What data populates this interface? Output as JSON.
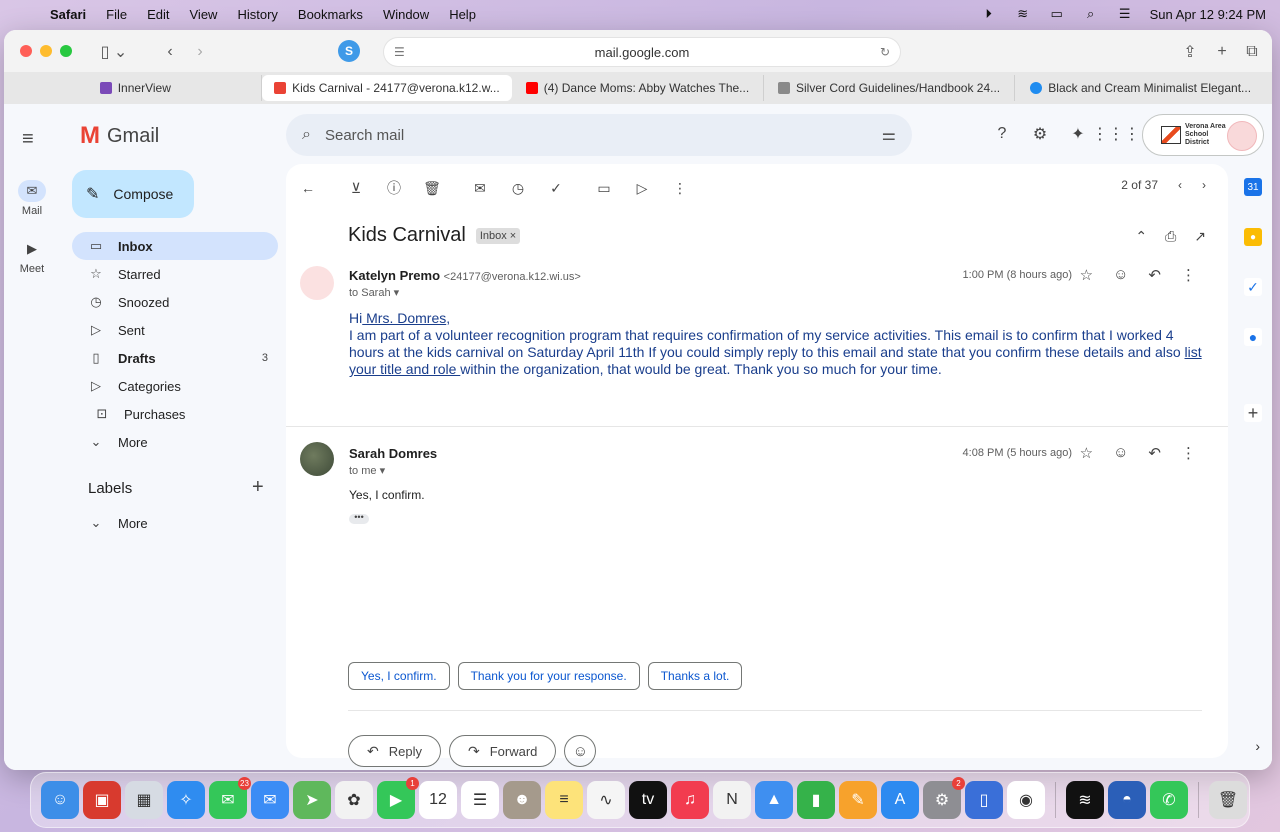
{
  "menubar": {
    "app": "Safari",
    "items": [
      "File",
      "Edit",
      "View",
      "History",
      "Bookmarks",
      "Window",
      "Help"
    ],
    "datetime": "Sun Apr 12  9:24 PM"
  },
  "browser": {
    "url": "mail.google.com",
    "tabs": [
      {
        "title": "InnerView",
        "color": "#7b4ab8"
      },
      {
        "title": "Kids Carnival - 24177@verona.k12.w...",
        "color": "#ea4335"
      },
      {
        "title": "(4) Dance Moms: Abby Watches The...",
        "color": "#ff0000"
      },
      {
        "title": "Silver Cord Guidelines/Handbook 24...",
        "color": "#8a8a8a"
      },
      {
        "title": "Black and Cream Minimalist Elegant...",
        "color": "#1f8cf0"
      }
    ]
  },
  "gmail": {
    "brand": "Gmail",
    "rail": {
      "mail": "Mail",
      "meet": "Meet"
    },
    "compose": "Compose",
    "search_placeholder": "Search mail",
    "nav": [
      {
        "label": "Inbox",
        "icon": "inbox-icon",
        "glyph": "▭"
      },
      {
        "label": "Starred",
        "icon": "star-icon",
        "glyph": "☆"
      },
      {
        "label": "Snoozed",
        "icon": "clock-icon",
        "glyph": "◷"
      },
      {
        "label": "Sent",
        "icon": "send-icon",
        "glyph": "▷"
      },
      {
        "label": "Drafts",
        "icon": "draft-icon",
        "glyph": "▯",
        "count": "3"
      },
      {
        "label": "Categories",
        "icon": "label-icon",
        "glyph": "▷"
      },
      {
        "label": "Purchases",
        "icon": "shopping-bag-icon",
        "glyph": "⊡"
      },
      {
        "label": "More",
        "icon": "chevron-down-icon",
        "glyph": "⌄"
      }
    ],
    "labels_heading": "Labels",
    "labels_more": "More",
    "account_org": "Verona Area School District",
    "pager": "2 of 37",
    "subject": "Kids Carnival",
    "subject_tag": "Inbox",
    "messages": [
      {
        "sender": "Katelyn Premo",
        "email": "<24177@verona.k12.wi.us>",
        "to": "to Sarah",
        "time": "1:00 PM (8 hours ago)",
        "greeting_pre": "Hi",
        "greeting_link": " Mrs. Domres",
        "greeting_post": ",",
        "body_pre": "I am part of a volunteer recognition program that requires confirmation of my service activities. This email is to confirm that I worked 4 hours at the kids carnival on Saturday April 11th If you could simply reply to this email and state that you confirm these details and also ",
        "body_link": "list your title and role ",
        "body_post": "within the organization, that would be great.  Thank you so much for your time."
      },
      {
        "sender": "Sarah Domres",
        "to": "to me",
        "time": "4:08 PM (5 hours ago)",
        "body": "Yes, I confirm."
      }
    ],
    "smart_replies": [
      "Yes, I confirm.",
      "Thank you for your response.",
      "Thanks a lot."
    ],
    "reply": "Reply",
    "forward": "Forward"
  },
  "dock": {
    "apps": [
      {
        "name": "finder",
        "color": "#3d8ee8",
        "glyph": "☺"
      },
      {
        "name": "photo-booth",
        "color": "#d83a2e",
        "glyph": "▣"
      },
      {
        "name": "launchpad",
        "color": "#d6dbe3",
        "glyph": "▦"
      },
      {
        "name": "safari",
        "color": "#2f8cf0",
        "glyph": "✧"
      },
      {
        "name": "messages",
        "color": "#34c759",
        "glyph": "✉",
        "badge": "23"
      },
      {
        "name": "mail",
        "color": "#3b8cf5",
        "glyph": "✉"
      },
      {
        "name": "maps",
        "color": "#5fb85c",
        "glyph": "➤"
      },
      {
        "name": "photos",
        "color": "#f2f2f2",
        "glyph": "✿"
      },
      {
        "name": "facetime",
        "color": "#34c759",
        "glyph": "▶",
        "badge": "1"
      },
      {
        "name": "calendar",
        "color": "#ffffff",
        "glyph": "12"
      },
      {
        "name": "reminders",
        "color": "#ffffff",
        "glyph": "☰"
      },
      {
        "name": "contacts",
        "color": "#a59a8c",
        "glyph": "☻"
      },
      {
        "name": "notes",
        "color": "#fde37a",
        "glyph": "≡"
      },
      {
        "name": "freeform",
        "color": "#f5f5f5",
        "glyph": "∿"
      },
      {
        "name": "apple-tv",
        "color": "#111111",
        "glyph": "tv"
      },
      {
        "name": "music",
        "color": "#f23c4f",
        "glyph": "♫"
      },
      {
        "name": "news",
        "color": "#f2f2f2",
        "glyph": "N"
      },
      {
        "name": "keynote",
        "color": "#3f8ff0",
        "glyph": "▲"
      },
      {
        "name": "numbers",
        "color": "#35b24a",
        "glyph": "▮"
      },
      {
        "name": "pages",
        "color": "#f7a22c",
        "glyph": "✎"
      },
      {
        "name": "app-store",
        "color": "#2d8af0",
        "glyph": "A"
      },
      {
        "name": "system-settings",
        "color": "#8e8e93",
        "glyph": "⚙",
        "badge": "2"
      },
      {
        "name": "simulator",
        "color": "#3a6fd8",
        "glyph": "▯"
      },
      {
        "name": "chrome",
        "color": "#ffffff",
        "glyph": "◉"
      },
      {
        "name": "spotify",
        "color": "#111111",
        "glyph": "≋"
      },
      {
        "name": "screen-app",
        "color": "#2b5fb8",
        "glyph": "◓"
      },
      {
        "name": "phone",
        "color": "#34c759",
        "glyph": "✆"
      },
      {
        "name": "trash",
        "color": "#dcdcdc",
        "glyph": "🗑"
      }
    ]
  }
}
